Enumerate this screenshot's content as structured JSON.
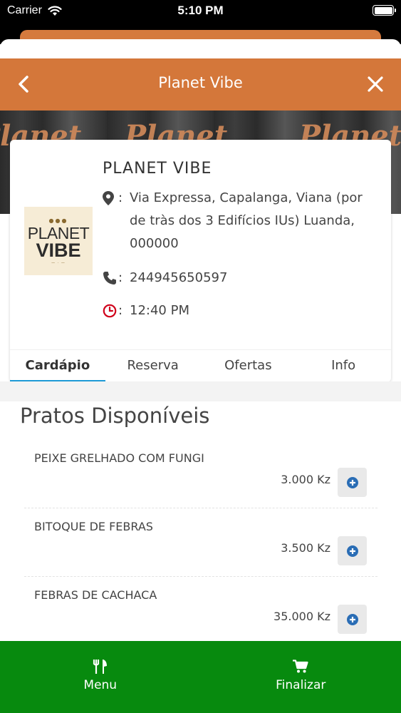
{
  "status_bar": {
    "carrier": "Carrier",
    "time": "5:10 PM"
  },
  "nav": {
    "title": "Planet Vibe"
  },
  "banner": {
    "watermark": "Planet"
  },
  "restaurant": {
    "logo_line1": "PLANET",
    "logo_line2": "VIBE",
    "name": "PLANET VIBE",
    "address": "Via Expressa, Capalanga, Viana (por de tràs dos 3 Edifícios IUs) Luanda, 000000",
    "phone": "244945650597",
    "hours": "12:40 PM",
    "colon": ":"
  },
  "tabs": [
    {
      "label": "Cardápio",
      "active": true
    },
    {
      "label": "Reserva",
      "active": false
    },
    {
      "label": "Ofertas",
      "active": false
    },
    {
      "label": "Info",
      "active": false
    }
  ],
  "section_title": "Pratos Disponíveis",
  "dishes": [
    {
      "name": "PEIXE GRELHADO COM FUNGI",
      "price": "3.000 Kz"
    },
    {
      "name": "BITOQUE DE FEBRAS",
      "price": "3.500 Kz"
    },
    {
      "name": "FEBRAS DE CACHACA",
      "price": "35.000 Kz"
    }
  ],
  "bottom_nav": [
    {
      "label": "Menu",
      "icon": "cutlery-icon"
    },
    {
      "label": "Finalizar",
      "icon": "cart-icon"
    }
  ],
  "colors": {
    "nav_orange": "#d4773a",
    "tab_indicator": "#1e9ad6",
    "bottom_green": "#078a0e",
    "add_icon_blue": "#2a6db5",
    "clock_red": "#d0021b"
  }
}
